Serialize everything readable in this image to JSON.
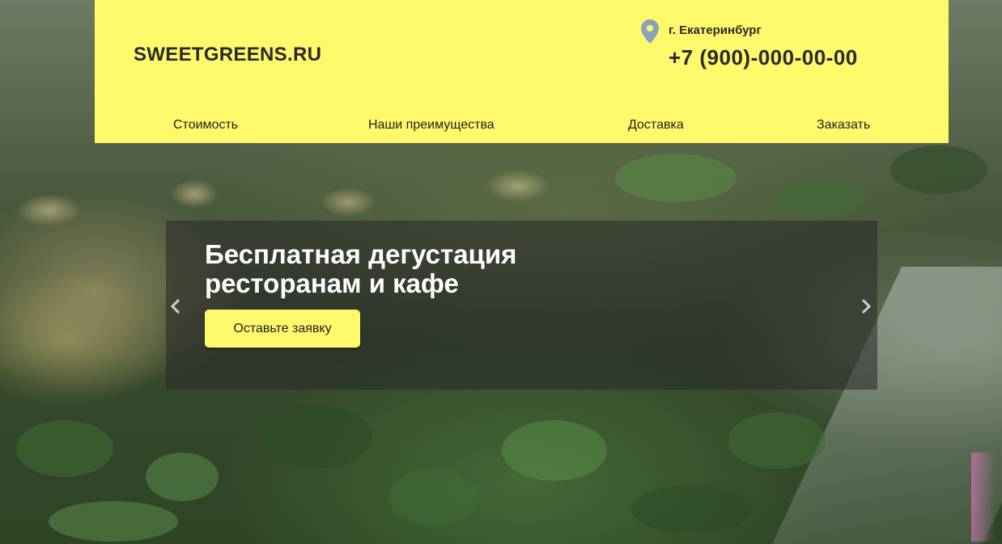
{
  "header": {
    "logo": "SWEETGREENS.RU",
    "city": "г. Екатеринбург",
    "phone": "+7 (900)-000-00-00",
    "nav": [
      {
        "label": "Стоимость"
      },
      {
        "label": "Наши преимущества"
      },
      {
        "label": "Доставка"
      },
      {
        "label": "Заказать"
      }
    ]
  },
  "slider": {
    "title_line1": "Бесплатная дегустация",
    "title_line2": "ресторанам и кафе",
    "cta_label": "Оставьте заявку",
    "prev_icon": "chevron-left-icon",
    "next_icon": "chevron-right-icon"
  },
  "colors": {
    "header_bg": "#fff96b",
    "button_bg": "#fff96b",
    "overlay": "rgba(40,40,40,0.55)",
    "pin": "#8aa2b8"
  }
}
